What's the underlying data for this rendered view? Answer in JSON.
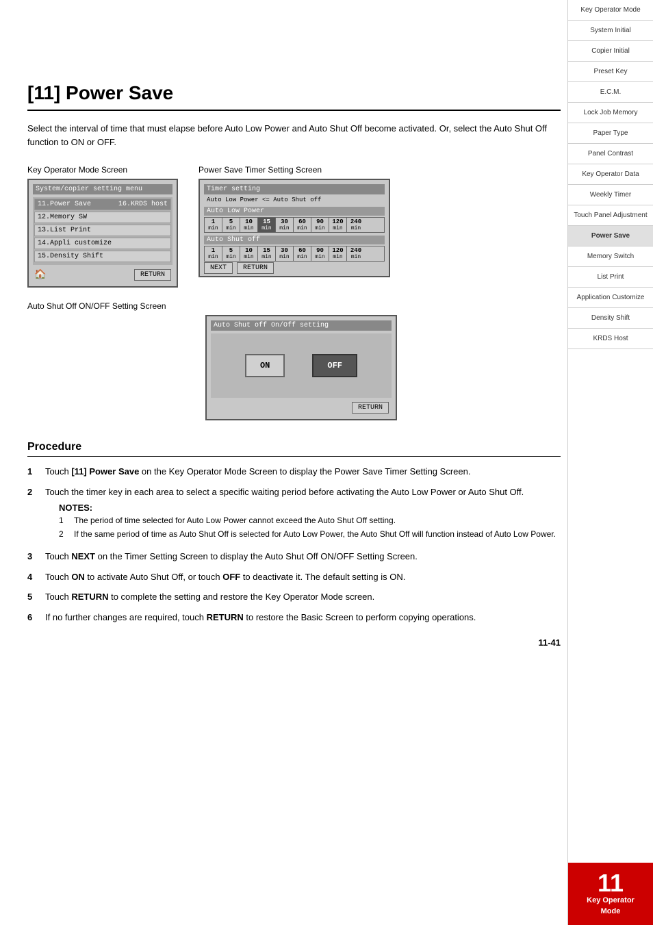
{
  "page": {
    "title": "[11] Power Save",
    "intro": "Select the interval of time that must elapse before Auto Low Power and Auto Shut Off become activated. Or, select the Auto Shut Off function to ON or OFF.",
    "page_number": "11-41"
  },
  "screens": {
    "key_operator": {
      "label": "Key Operator Mode Screen",
      "title": "System/copier setting menu",
      "items": [
        {
          "num": "11",
          "label": "Power Save",
          "right": "16.KRDS host"
        },
        {
          "num": "12",
          "label": "Memory SW",
          "right": ""
        },
        {
          "num": "13",
          "label": "List Print",
          "right": ""
        },
        {
          "num": "14",
          "label": "Appli customize",
          "right": ""
        },
        {
          "num": "15",
          "label": "Density Shift",
          "right": ""
        }
      ],
      "return_btn": "RETURN"
    },
    "timer": {
      "label": "Power Save Timer Setting Screen",
      "title": "Timer setting",
      "subtitle": "Auto Low Power <= Auto Shut off",
      "auto_low_power_label": "Auto Low Power",
      "auto_shut_label": "Auto Shut off",
      "timer_values": [
        "1",
        "5",
        "10",
        "15",
        "30",
        "60",
        "90",
        "120",
        "240"
      ],
      "timer_units": [
        "min",
        "min",
        "min",
        "min",
        "min",
        "min",
        "min",
        "min",
        "min"
      ],
      "next_btn": "NEXT",
      "return_btn": "RETURN"
    },
    "shutoff": {
      "label": "Auto Shut Off ON/OFF Setting Screen",
      "title": "Auto Shut off On/Off setting",
      "on_btn": "ON",
      "off_btn": "OFF",
      "return_btn": "RETURN"
    }
  },
  "procedure": {
    "title": "Procedure",
    "steps": [
      {
        "num": "1",
        "text": "Touch [11] Power Save on the Key Operator Mode Screen to display the Power Save Timer Setting Screen."
      },
      {
        "num": "2",
        "text": "Touch the timer key in each area to select a specific waiting period before activating the Auto Low Power or Auto Shut Off."
      },
      {
        "num": "3",
        "text": "Touch NEXT on the Timer Setting Screen to display the Auto Shut Off ON/OFF Setting Screen."
      },
      {
        "num": "4",
        "text": "Touch ON to activate Auto Shut Off, or touch OFF to deactivate it. The default setting is ON."
      },
      {
        "num": "5",
        "text": "Touch RETURN to complete the setting and restore the Key Operator Mode screen."
      },
      {
        "num": "6",
        "text": "If no further changes are required, touch RETURN to restore the Basic Screen to perform copying operations."
      }
    ],
    "notes": {
      "title": "NOTES:",
      "items": [
        "The period of time selected for Auto Low Power cannot exceed the Auto Shut Off setting.",
        "If the same period of time as Auto Shut Off is selected for Auto Low Power, the Auto Shut Off will function instead of Auto Low Power."
      ]
    }
  },
  "sidebar": {
    "items": [
      {
        "label": "Key Operator Mode",
        "active": false
      },
      {
        "label": "System Initial",
        "active": false
      },
      {
        "label": "Copier Initial",
        "active": false
      },
      {
        "label": "Preset Key",
        "active": false
      },
      {
        "label": "E.C.M.",
        "active": false
      },
      {
        "label": "Lock Job Memory",
        "active": false
      },
      {
        "label": "Paper Type",
        "active": false
      },
      {
        "label": "Panel Contrast",
        "active": false
      },
      {
        "label": "Key Operator Data",
        "active": false
      },
      {
        "label": "Weekly Timer",
        "active": false
      },
      {
        "label": "Touch Panel Adjustment",
        "active": false
      },
      {
        "label": "Power Save",
        "active": true
      },
      {
        "label": "Memory Switch",
        "active": false
      },
      {
        "label": "List Print",
        "active": false
      },
      {
        "label": "Application Customize",
        "active": false
      },
      {
        "label": "Density Shift",
        "active": false
      },
      {
        "label": "KRDS Host",
        "active": false
      }
    ],
    "badge": {
      "number": "11",
      "label": "Key Operator\nMode"
    }
  }
}
